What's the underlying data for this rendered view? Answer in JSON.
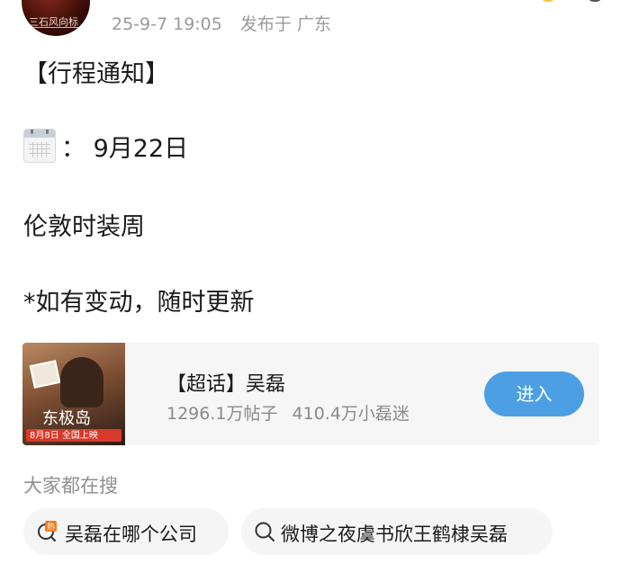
{
  "header": {
    "avatar_text": "三石风向标",
    "timestamp": "25-9-7 19:05",
    "location": "发布于 广东"
  },
  "post": {
    "line1": "【行程通知】",
    "calendar_icon": "calendar-icon",
    "line2": "： 9月22日",
    "line3": "伦敦时装周",
    "line4": "*如有变动，随时更新"
  },
  "topic_card": {
    "thumb_title": "东极岛",
    "thumb_strip": "8月8日 全国上映",
    "title": "【超话】吴磊",
    "posts": "1296.1万帖子",
    "fans": "410.4万小磊迷",
    "enter_label": "进入",
    "accent_color": "#4d9fe3"
  },
  "search": {
    "heading": "大家都在搜",
    "chips": [
      {
        "label": "吴磊在哪个公司",
        "icon": "hot-search-icon"
      },
      {
        "label": "微博之夜虞书欣王鹤棣吴磊",
        "icon": "search-icon"
      }
    ]
  }
}
